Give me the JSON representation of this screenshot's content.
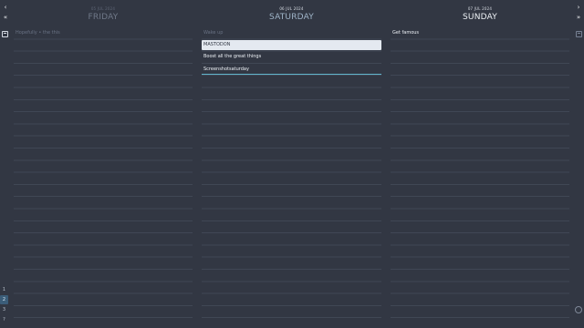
{
  "nav": {
    "prev_day_label": "‹",
    "prev_week_label": "«",
    "next_day_label": "›",
    "next_week_label": "»",
    "help_label": "?"
  },
  "weeks": [
    {
      "label": "1",
      "active": false
    },
    {
      "label": "2",
      "active": true
    },
    {
      "label": "3",
      "active": false
    }
  ],
  "days": [
    {
      "date": "05 JUL 2024",
      "weekday": "FRIDAY",
      "tasks": [
        {
          "label": "Hopefully • the this",
          "done": true
        }
      ]
    },
    {
      "date": "06 JUL 2024",
      "weekday": "SATURDAY",
      "tasks": [
        {
          "label": "Wake up",
          "done": true
        },
        {
          "label": "MASTODON",
          "selected": true
        },
        {
          "label": "Boost all the great things"
        },
        {
          "label": "Screenshotsaturday",
          "editing": true
        }
      ]
    },
    {
      "date": "07 JUL 2024",
      "weekday": "SUNDAY",
      "tasks": [
        {
          "label": "Get famous"
        }
      ]
    }
  ]
}
